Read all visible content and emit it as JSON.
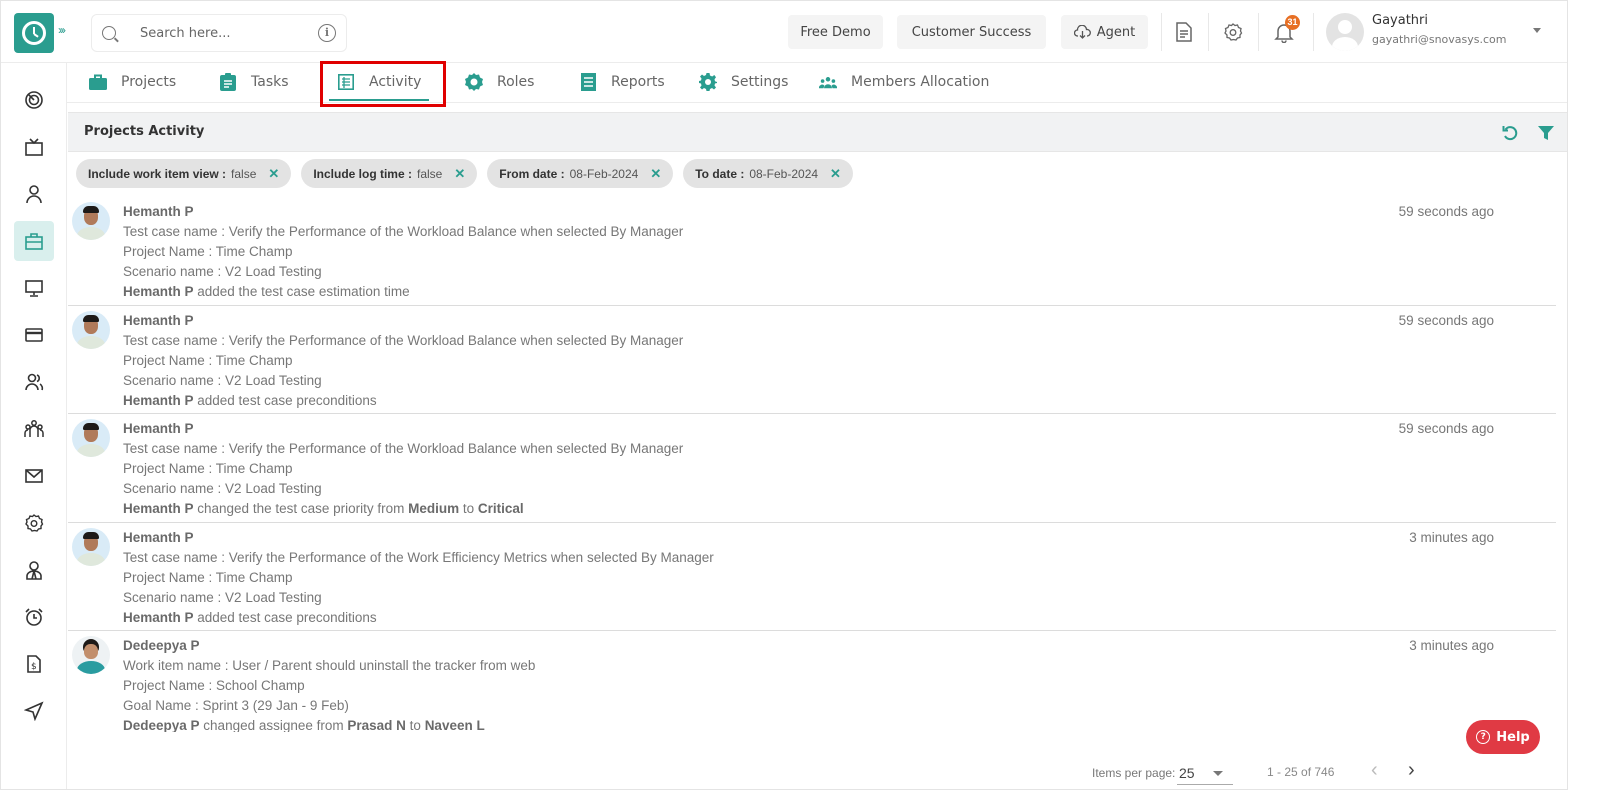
{
  "header": {
    "search_placeholder": "Search here...",
    "buttons": {
      "free_demo": "Free Demo",
      "customer_success": "Customer Success",
      "agent": "Agent"
    },
    "notification_count": "31",
    "user": {
      "name": "Gayathri",
      "email": "gayathri@snovasys.com"
    }
  },
  "sidebar": {
    "items": [
      {
        "icon": "dashboard-icon"
      },
      {
        "icon": "tv-icon"
      },
      {
        "icon": "user-icon"
      },
      {
        "icon": "briefcase-icon",
        "active": true
      },
      {
        "icon": "monitor-icon"
      },
      {
        "icon": "credit-card-icon"
      },
      {
        "icon": "users-icon"
      },
      {
        "icon": "team-icon"
      },
      {
        "icon": "mail-icon"
      },
      {
        "icon": "settings-icon"
      },
      {
        "icon": "employee-icon"
      },
      {
        "icon": "alarm-icon"
      },
      {
        "icon": "invoice-icon"
      },
      {
        "icon": "send-icon"
      }
    ]
  },
  "tabs": [
    {
      "label": "Projects",
      "icon": "briefcase-icon"
    },
    {
      "label": "Tasks",
      "icon": "clipboard-icon"
    },
    {
      "label": "Activity",
      "icon": "list-icon",
      "active": true
    },
    {
      "label": "Roles",
      "icon": "roles-icon"
    },
    {
      "label": "Reports",
      "icon": "reports-icon"
    },
    {
      "label": "Settings",
      "icon": "gear-icon"
    },
    {
      "label": "Members Allocation",
      "icon": "members-icon"
    }
  ],
  "panel": {
    "title": "Projects Activity"
  },
  "filters": [
    {
      "key": "Include work item view :",
      "value": "false"
    },
    {
      "key": "Include log time :",
      "value": "false"
    },
    {
      "key": "From date :",
      "value": "08-Feb-2024"
    },
    {
      "key": "To date :",
      "value": "08-Feb-2024"
    }
  ],
  "activities": [
    {
      "user": "Hemanth P",
      "time": "59 seconds ago",
      "line1": "Test case name : Verify the Performance of the Workload Balance when selected By Manager",
      "line2": "Project Name : Time Champ",
      "line3": "Scenario name : V2 Load Testing",
      "actor": "Hemanth P",
      "action": " added the test case estimation time",
      "from_label": "",
      "from": "",
      "to_label": "",
      "to": ""
    },
    {
      "user": "Hemanth P",
      "time": "59 seconds ago",
      "line1": "Test case name : Verify the Performance of the Workload Balance when selected By Manager",
      "line2": "Project Name : Time Champ",
      "line3": "Scenario name : V2 Load Testing",
      "actor": "Hemanth P",
      "action": " added test case preconditions",
      "from_label": "",
      "from": "",
      "to_label": "",
      "to": ""
    },
    {
      "user": "Hemanth P",
      "time": "59 seconds ago",
      "line1": "Test case name : Verify the Performance of the Workload Balance when selected By Manager",
      "line2": "Project Name : Time Champ",
      "line3": "Scenario name : V2 Load Testing",
      "actor": "Hemanth P",
      "action": " changed the test case priority from ",
      "from": "Medium",
      "to_label": " to ",
      "to": "Critical"
    },
    {
      "user": "Hemanth P",
      "time": "3 minutes ago",
      "line1": "Test case name : Verify the Performance of the Work Efficiency Metrics when selected By Manager",
      "line2": "Project Name : Time Champ",
      "line3": "Scenario name : V2 Load Testing",
      "actor": "Hemanth P",
      "action": " added test case preconditions",
      "from": "",
      "to_label": "",
      "to": ""
    },
    {
      "user": "Dedeepya P",
      "time": "3 minutes ago",
      "line1": "Work item name : User / Parent should uninstall the tracker from web",
      "line2": "Project Name : School Champ",
      "line3": "Goal Name : Sprint 3 (29 Jan - 9 Feb)",
      "actor": "Dedeepya P",
      "action": " changed assignee from ",
      "from": "Prasad N",
      "to_label": " to ",
      "to": "Naveen L"
    }
  ],
  "help_label": "Help",
  "pagination": {
    "items_per_page_label": "Items per page:",
    "items_per_page": "25",
    "range": "1 - 25 of 746"
  },
  "colors": {
    "accent": "#2a9d8f",
    "highlight": "#e00000",
    "help": "#e03a44",
    "badge": "#e76f24"
  }
}
